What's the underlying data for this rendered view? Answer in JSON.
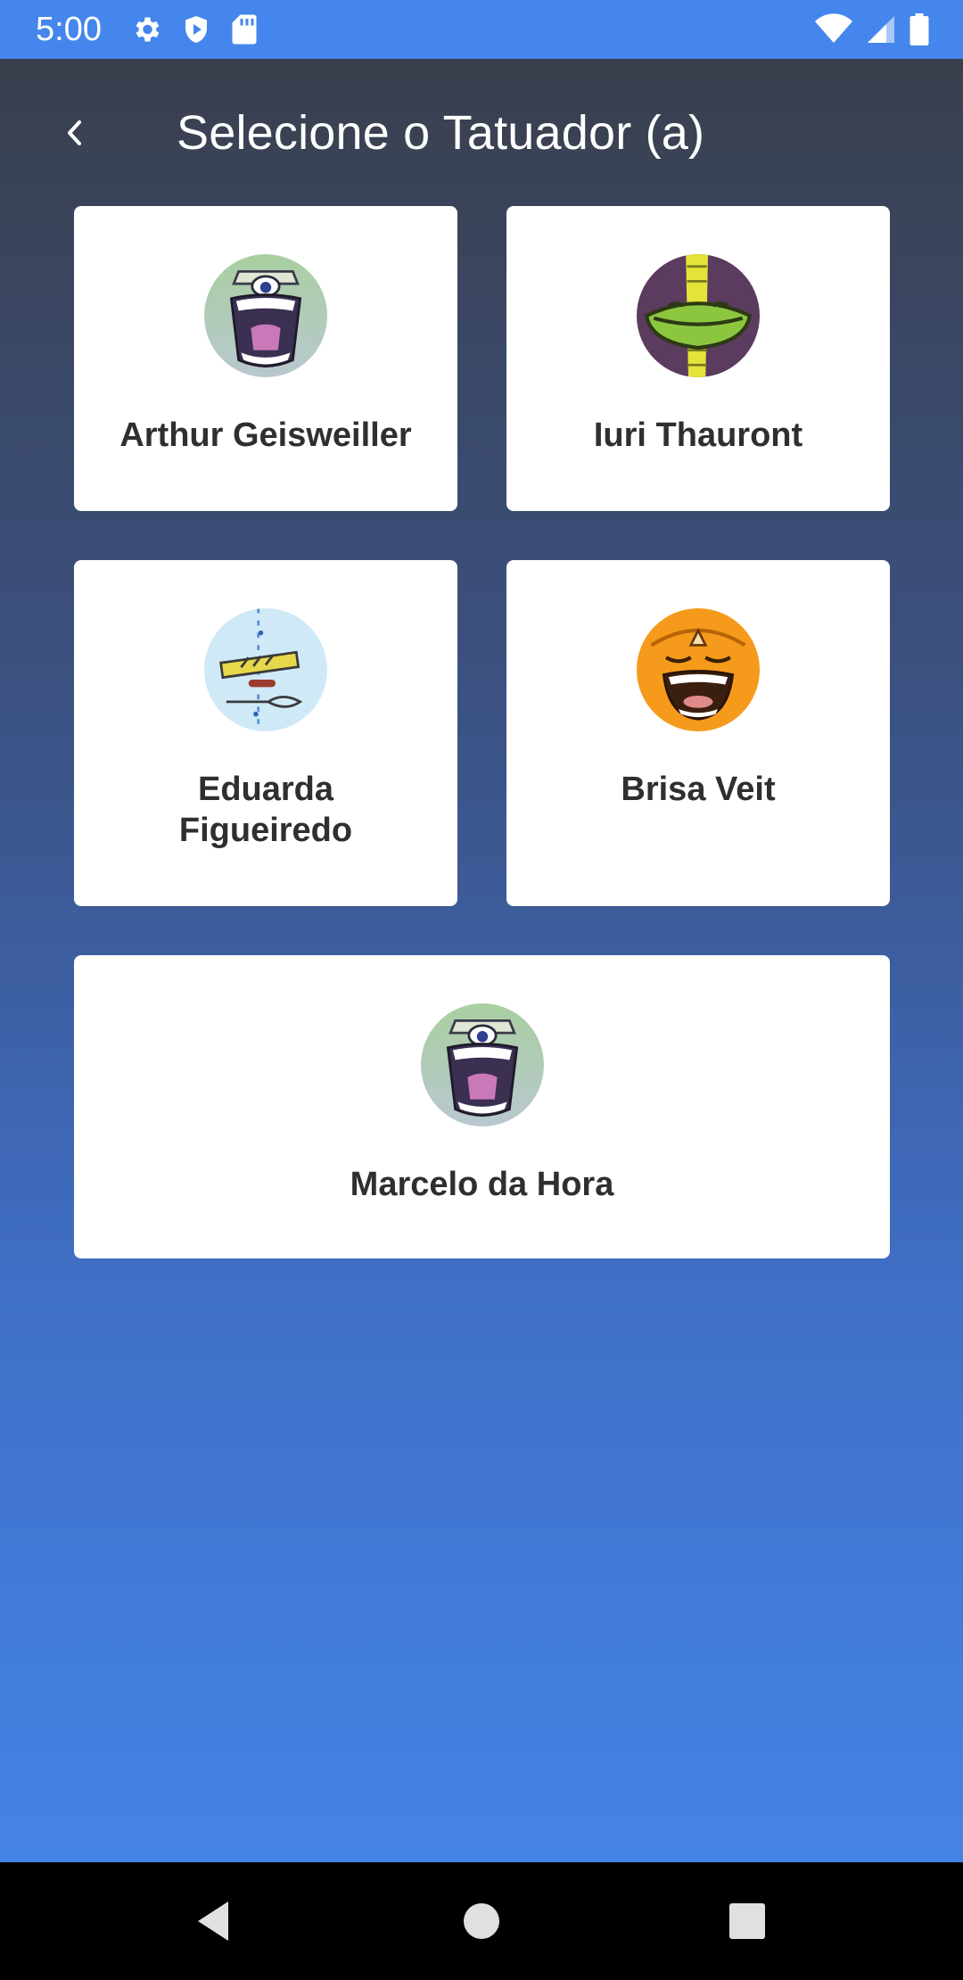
{
  "status_bar": {
    "time": "5:00",
    "left_icons": [
      "settings-icon",
      "shield-play-icon",
      "sd-card-icon"
    ],
    "right_icons": [
      "wifi-icon",
      "cell-signal-icon",
      "battery-icon"
    ],
    "color": "#4486ec"
  },
  "header": {
    "title": "Selecione o Tatuador (a)",
    "back_icon": "chevron-left-icon"
  },
  "artists": [
    {
      "name": "Arthur Geisweiller",
      "avatar": "monster-avatar-icon"
    },
    {
      "name": "Iuri Thauront",
      "avatar": "pickle-avatar-icon"
    },
    {
      "name": "Eduarda Figueiredo",
      "avatar": "sketch-avatar-icon"
    },
    {
      "name": "Brisa Veit",
      "avatar": "orange-face-avatar-icon"
    },
    {
      "name": "Marcelo da Hora",
      "avatar": "monster-avatar-icon"
    }
  ],
  "nav_bar": {
    "icons": [
      "back-triangle-icon",
      "home-circle-icon",
      "recents-square-icon"
    ]
  }
}
